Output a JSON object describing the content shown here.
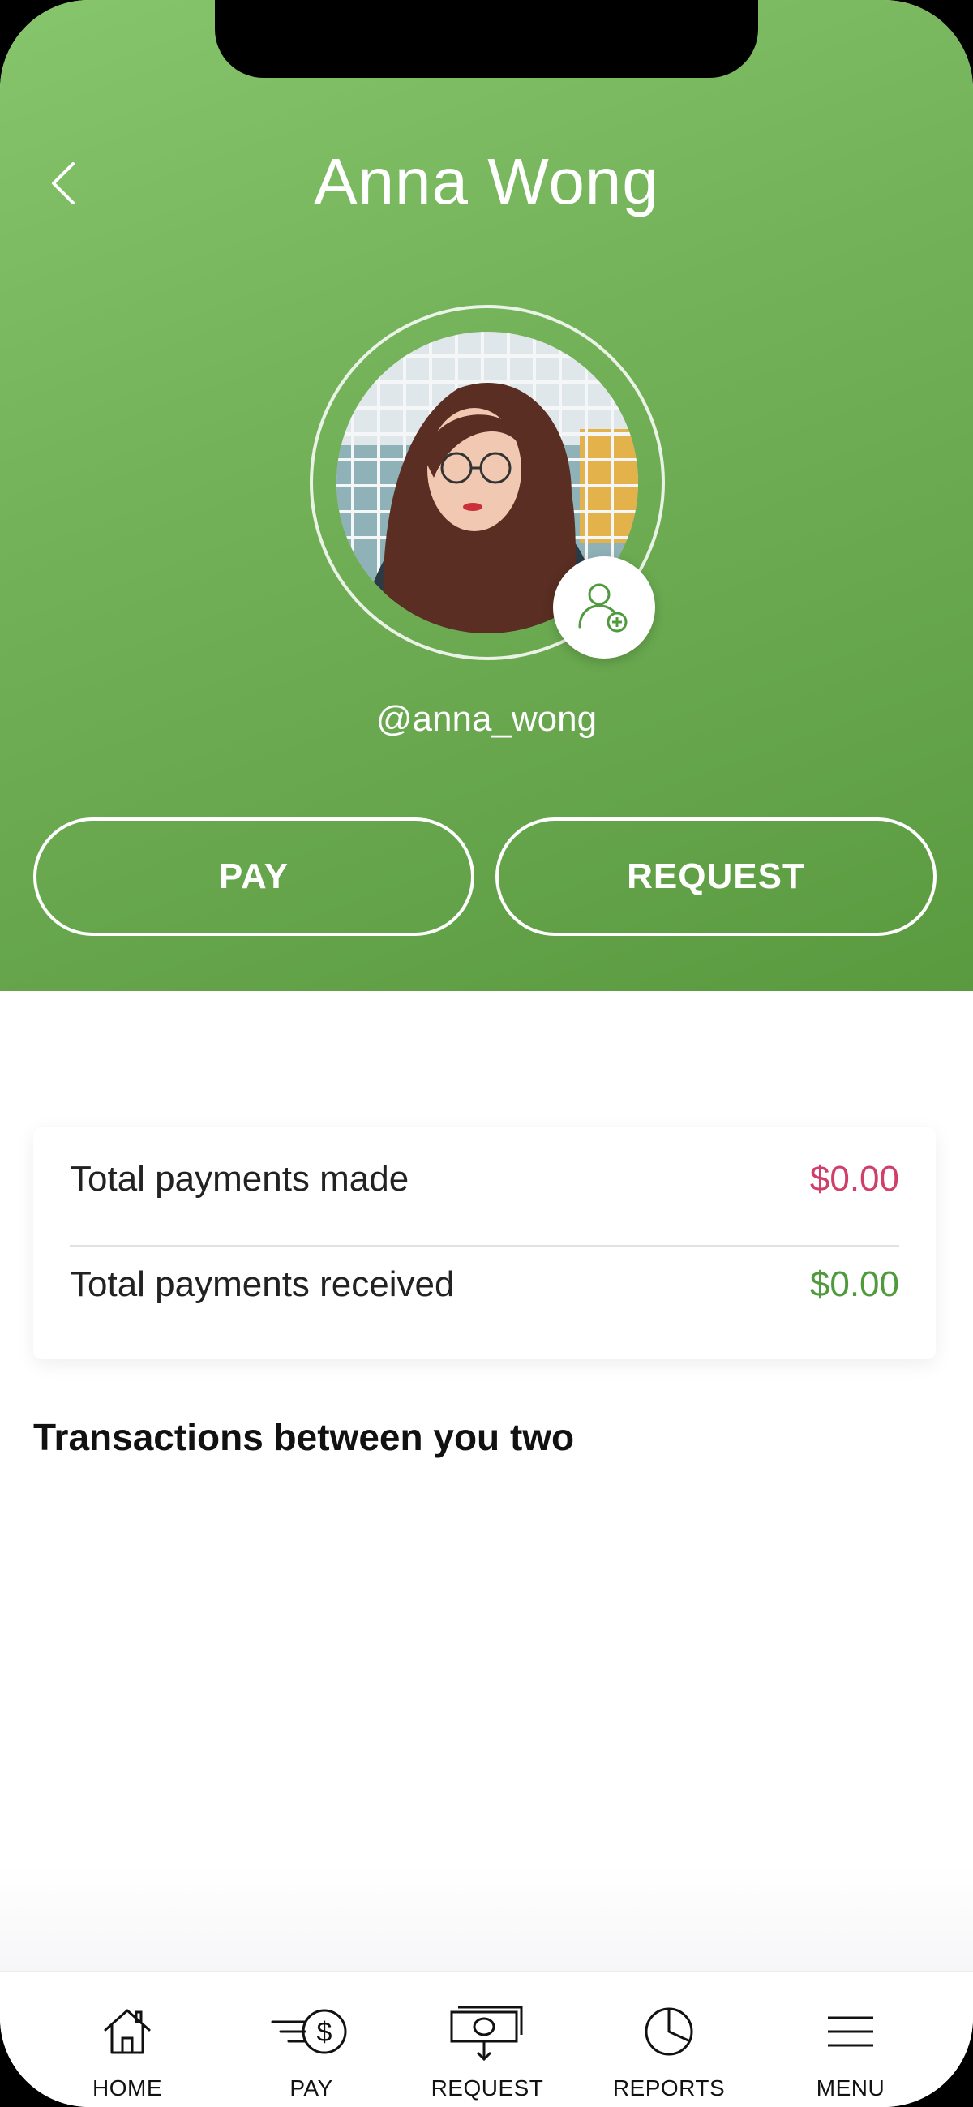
{
  "header": {
    "title": "Anna Wong",
    "handle": "@anna_wong",
    "pay_label": "PAY",
    "request_label": "REQUEST"
  },
  "summary": {
    "made_label": "Total payments made",
    "made_value": "$0.00",
    "received_label": "Total payments received",
    "received_value": "$0.00"
  },
  "transactions": {
    "title": "Transactions between you two"
  },
  "nav": {
    "items": [
      {
        "label": "HOME",
        "icon": "home-icon"
      },
      {
        "label": "PAY",
        "icon": "pay-icon"
      },
      {
        "label": "REQUEST",
        "icon": "request-icon"
      },
      {
        "label": "REPORTS",
        "icon": "reports-icon"
      },
      {
        "label": "MENU",
        "icon": "menu-icon"
      }
    ]
  },
  "colors": {
    "brand_green": "#6fae55",
    "made_amount": "#cf3f6a",
    "received_amount": "#4f9a3c"
  }
}
